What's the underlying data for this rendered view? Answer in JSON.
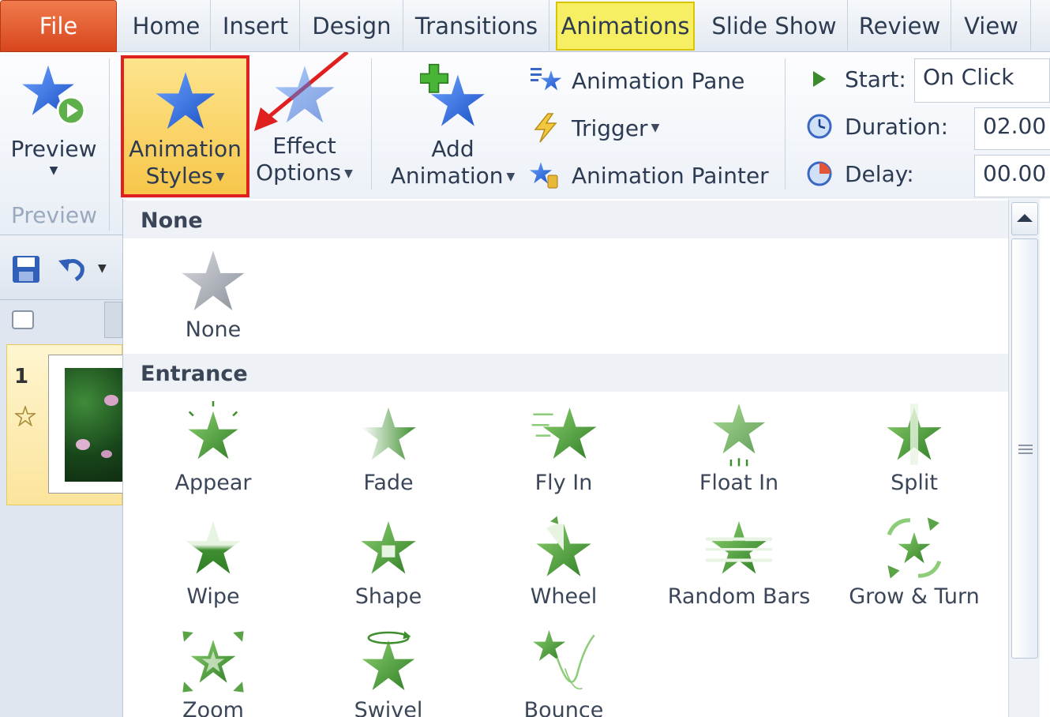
{
  "tabs": [
    "File",
    "Home",
    "Insert",
    "Design",
    "Transitions",
    "Animations",
    "Slide Show",
    "Review",
    "View"
  ],
  "ribbon": {
    "preview": {
      "label": "Preview",
      "group_label": "Preview"
    },
    "animation_styles": {
      "line1": "Animation",
      "line2": "Styles"
    },
    "effect_options": {
      "line1": "Effect",
      "line2": "Options"
    },
    "add_animation": {
      "line1": "Add",
      "line2": "Animation"
    },
    "animation_pane": "Animation Pane",
    "trigger": "Trigger",
    "animation_painter": "Animation Painter",
    "timing": {
      "start_label": "Start:",
      "start_value": "On Click",
      "duration_label": "Duration:",
      "duration_value": "02.00",
      "delay_label": "Delay:",
      "delay_value": "00.00"
    }
  },
  "sidebar": {
    "slide_number": "1"
  },
  "gallery": {
    "none_header": "None",
    "none_item": "None",
    "entrance_header": "Entrance",
    "entrance_items": [
      "Appear",
      "Fade",
      "Fly In",
      "Float In",
      "Split",
      "Wipe",
      "Shape",
      "Wheel",
      "Random Bars",
      "Grow & Turn",
      "Zoom",
      "Swivel",
      "Bounce"
    ]
  },
  "colors": {
    "highlight_border": "#e01f1f",
    "active_tab": "#f6ee63",
    "file_tab": "#e05a2b",
    "entrance_star": "#4e9a3c"
  }
}
